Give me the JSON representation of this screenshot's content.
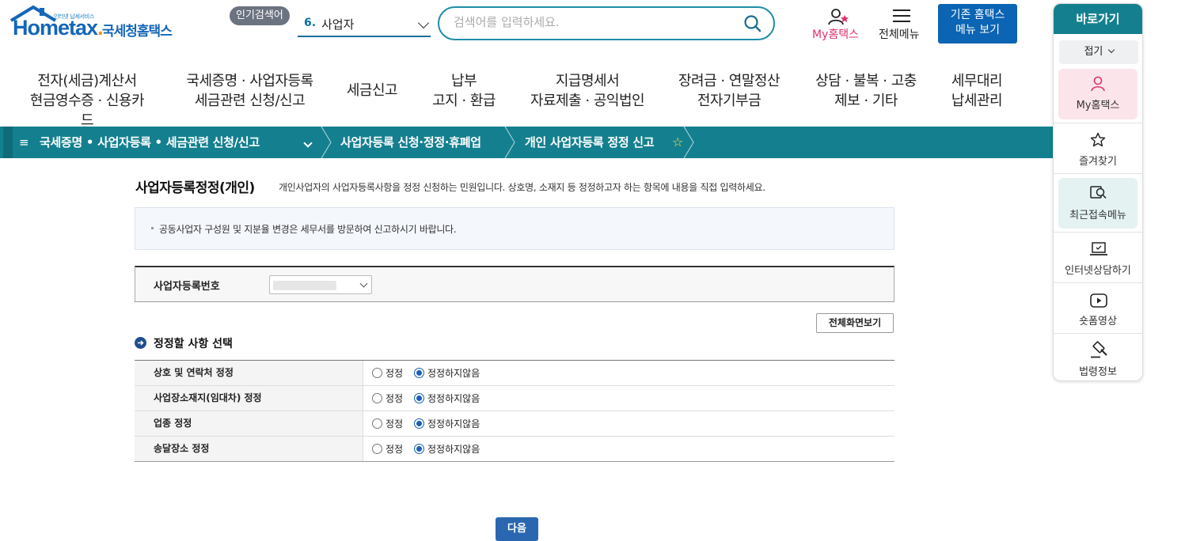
{
  "header": {
    "logo_small": "인터넷 납세서비스",
    "logo_word_a": "Home",
    "logo_word_b": "tax",
    "logo_word_dot": ".",
    "logo_korean": "국세청홈택스",
    "popular_badge": "인기검색어",
    "popular_num": "6.",
    "popular_term": "사업자",
    "search_placeholder": "검색어를 입력하세요.",
    "my_hometax": "My홈택스",
    "menu_all": "전체메뉴",
    "legacy_line1": "기존 홈택스",
    "legacy_line2": "메뉴 보기"
  },
  "gnb": [
    {
      "line1": "전자(세금)계산서",
      "line2": "현금영수증 · 신용카드"
    },
    {
      "line1": "국세증명 · 사업자등록",
      "line2": "세금관련 신청/신고"
    },
    {
      "line1": "세금신고",
      "line2": ""
    },
    {
      "line1": "납부",
      "line2": "고지 · 환급"
    },
    {
      "line1": "지급명세서",
      "line2": "자료제출 · 공익법인"
    },
    {
      "line1": "장려금 · 연말정산",
      "line2": "전자기부금"
    },
    {
      "line1": "상담 · 불복 · 고충",
      "line2": "제보 · 기타"
    },
    {
      "line1": "세무대리",
      "line2": "납세관리"
    }
  ],
  "breadcrumb": {
    "menu_icon": "≡",
    "level1": "국세증명 • 사업자등록 • 세금관련 신청/신고",
    "level2": "사업자등록 신청·정정·휴폐업",
    "level3": "개인 사업자등록 정정 신고",
    "star": "☆"
  },
  "quick": {
    "title": "바로가기",
    "fold": "접기",
    "items": [
      {
        "label": "My홈택스",
        "icon": "person-icon"
      },
      {
        "label": "즐겨찾기",
        "icon": "star-icon"
      },
      {
        "label": "최근접속메뉴",
        "icon": "recent-search-icon"
      },
      {
        "label": "인터넷상담하기",
        "icon": "laptop-icon"
      },
      {
        "label": "숏폼영상",
        "icon": "play-icon"
      },
      {
        "label": "법령정보",
        "icon": "gavel-icon"
      }
    ]
  },
  "main": {
    "title": "사업자등록정정(개인)",
    "description": "개인사업자의 사업자등록사항을 정정 신청하는 민원입니다. 상호명, 소재지 등 정정하고자 하는 항목에 내용을 직접 입력하세요.",
    "notice": "공동사업자 구성원 및 지분율 변경은 세무서를 방문하여 신고하시기 바랍니다.",
    "bizno_label": "사업자등록번호",
    "full_view_button": "전체화면보기",
    "section_title": "정정할 사항 선택",
    "rows": [
      {
        "label": "상호 및 연락처 정정",
        "opt_yes": "정정",
        "opt_no": "정정하지않음",
        "selected": "no"
      },
      {
        "label": "사업장소재지(임대차) 정정",
        "opt_yes": "정정",
        "opt_no": "정정하지않음",
        "selected": "no"
      },
      {
        "label": "업종 정정",
        "opt_yes": "정정",
        "opt_no": "정정하지않음",
        "selected": "no"
      },
      {
        "label": "송달장소 정정",
        "opt_yes": "정정",
        "opt_no": "정정하지않음",
        "selected": "no"
      }
    ],
    "next_button": "다음"
  },
  "colors": {
    "teal": "#14808f",
    "brand_blue": "#0b64b4",
    "pink": "#e0316b"
  }
}
